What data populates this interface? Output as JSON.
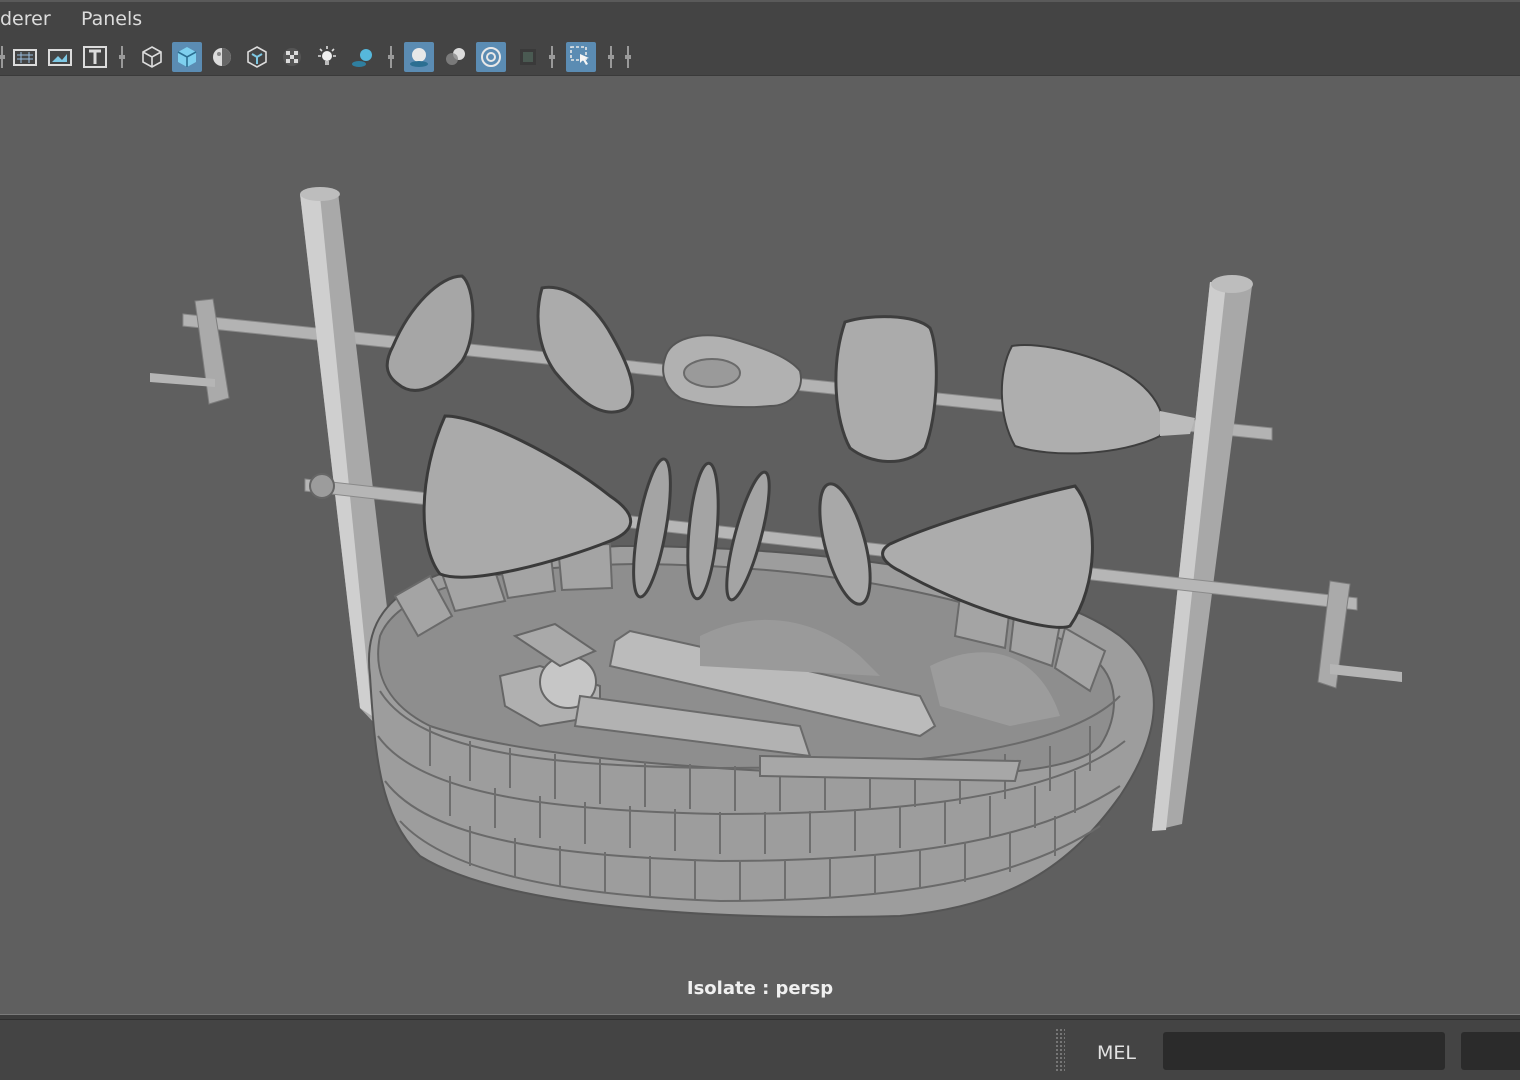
{
  "menubar": {
    "items": [
      {
        "label": "derer"
      },
      {
        "label": "Panels"
      }
    ]
  },
  "toolbar": {
    "icons": [
      "grid-icon",
      "film-gate-icon",
      "image-plane-icon",
      "text-label-icon",
      "wireframe-icon",
      "smooth-shade-icon",
      "default-material-icon",
      "textured-icon",
      "checker-icon",
      "lights-icon",
      "shadows-icon",
      "ambient-occlusion-icon",
      "motion-blur-icon",
      "isolate-select-icon",
      "xray-icon",
      "xray-joints-icon",
      "select-highlight-icon"
    ]
  },
  "viewport": {
    "camera_label": "Isolate : persp",
    "scene_description_icon": "spit-roast-model"
  },
  "commandline": {
    "language_label": "MEL",
    "input_value": "",
    "result_value": ""
  },
  "colors": {
    "panel_bg": "#444444",
    "viewport_bg": "#5f5f5f",
    "active_button": "#5b8cb3",
    "input_bg": "#2b2b2b"
  }
}
